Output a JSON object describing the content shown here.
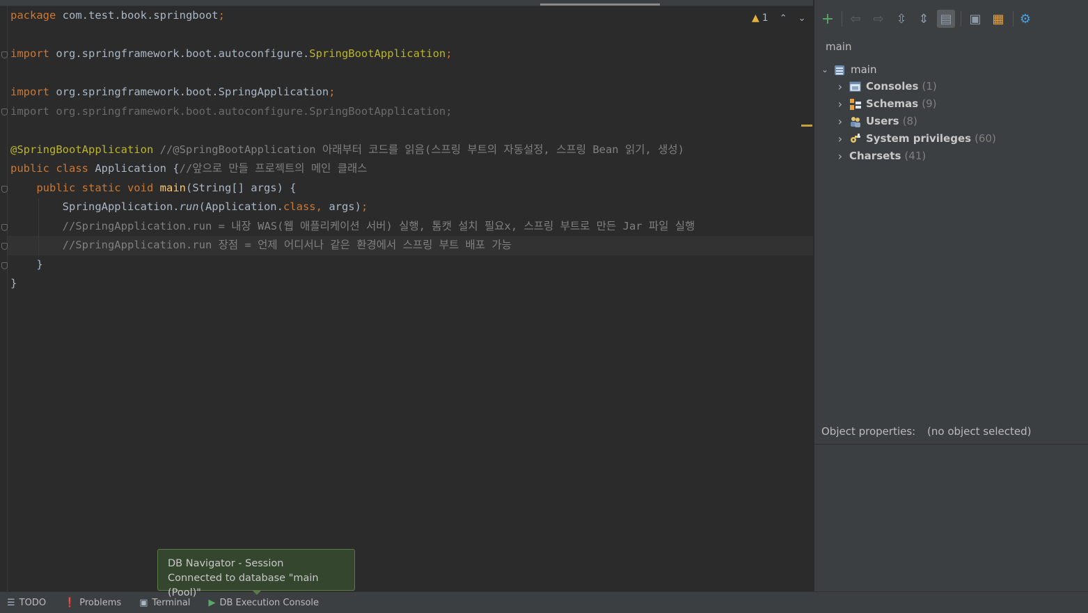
{
  "editor": {
    "lines": [
      [
        {
          "t": "package",
          "c": "kw"
        },
        {
          "t": " com.test.book.springboot"
        },
        {
          "t": ";",
          "c": "punc"
        }
      ],
      [],
      [
        {
          "t": "import",
          "c": "kw"
        },
        {
          "t": " org.springframework.boot.autoconfigure."
        },
        {
          "t": "SpringBootApplication",
          "c": "ann"
        },
        {
          "t": ";",
          "c": "punc"
        }
      ],
      [],
      [
        {
          "t": "import",
          "c": "kw"
        },
        {
          "t": " org.springframework.boot.SpringApplication"
        },
        {
          "t": ";",
          "c": "punc"
        }
      ],
      [
        {
          "t": "import org.springframework.boot.autoconfigure.SpringBootApplication;",
          "c": "dim"
        }
      ],
      [],
      [
        {
          "t": "@SpringBootApplication",
          "c": "ann"
        },
        {
          "t": " //@SpringBootApplication 아래부터 코드를 읽음(스프링 부트의 자동설정, 스프링 Bean 읽기, 생성)",
          "c": "cm"
        }
      ],
      [
        {
          "t": "public class",
          "c": "kw"
        },
        {
          "t": " Application {"
        },
        {
          "t": "//앞으로 만들 프로젝트의 메인 클래스",
          "c": "cm"
        }
      ],
      [
        {
          "t": "    "
        },
        {
          "t": "public static void",
          "c": "kw"
        },
        {
          "t": " "
        },
        {
          "t": "main",
          "c": "fn"
        },
        {
          "t": "(String[] args) {"
        }
      ],
      [
        {
          "t": "        SpringApplication."
        },
        {
          "t": "run",
          "c": "it"
        },
        {
          "t": "(Application."
        },
        {
          "t": "class",
          "c": "kw"
        },
        {
          "t": ", ",
          "c": "punc"
        },
        {
          "t": "args)"
        },
        {
          "t": ";",
          "c": "punc"
        }
      ],
      [
        {
          "t": "        "
        },
        {
          "t": "//SpringApplication.run = 내장 WAS(웹 애플리케이션 서버) 실행, 톰캣 설치 필요x, 스프링 부트로 만든 Jar 파일 실행",
          "c": "cm"
        }
      ],
      [
        {
          "t": "        "
        },
        {
          "t": "//SpringApplication.run 장점 = 언제 어디서나 같은 환경에서 스프링 부트 배포 가능",
          "c": "cm"
        }
      ],
      [
        {
          "t": "    }"
        }
      ],
      [
        {
          "t": "}"
        }
      ]
    ],
    "inspection": {
      "warning_count": "1",
      "up": "⌃",
      "down": "⌄"
    }
  },
  "db_panel": {
    "header": "main",
    "toolbar": [
      "add-icon",
      "back-icon",
      "forward-icon",
      "expand-all-icon",
      "collapse-all-icon",
      "filter-icon",
      "open-console-icon",
      "new-console-icon",
      "settings-icon"
    ],
    "tree": {
      "root": {
        "label": "main"
      },
      "children": [
        {
          "label": "Consoles",
          "count": "(1)",
          "icon": "consoles-icon"
        },
        {
          "label": "Schemas",
          "count": "(9)",
          "icon": "schemas-icon"
        },
        {
          "label": "Users",
          "count": "(8)",
          "icon": "users-icon"
        },
        {
          "label": "System privileges",
          "count": "(60)",
          "icon": "privileges-icon"
        },
        {
          "label": "Charsets",
          "count": "(41)",
          "icon": ""
        }
      ]
    },
    "properties": {
      "label": "Object properties:",
      "value": "(no object selected)"
    }
  },
  "bottom_bar": {
    "items": [
      {
        "label": "TODO",
        "icon": "list-icon"
      },
      {
        "label": "Problems",
        "icon": "problems-icon"
      },
      {
        "label": "Terminal",
        "icon": "terminal-icon"
      },
      {
        "label": "DB Execution Console",
        "icon": "db-console-icon"
      }
    ]
  },
  "notification": {
    "title": "DB Navigator - Session",
    "message": "Connected to database \"main (Pool)\""
  },
  "colors": {
    "keyword": "#cc7832",
    "annotation": "#bbb529",
    "comment": "#808080",
    "method": "#ffc66d",
    "notification_bg": "#35462f"
  }
}
